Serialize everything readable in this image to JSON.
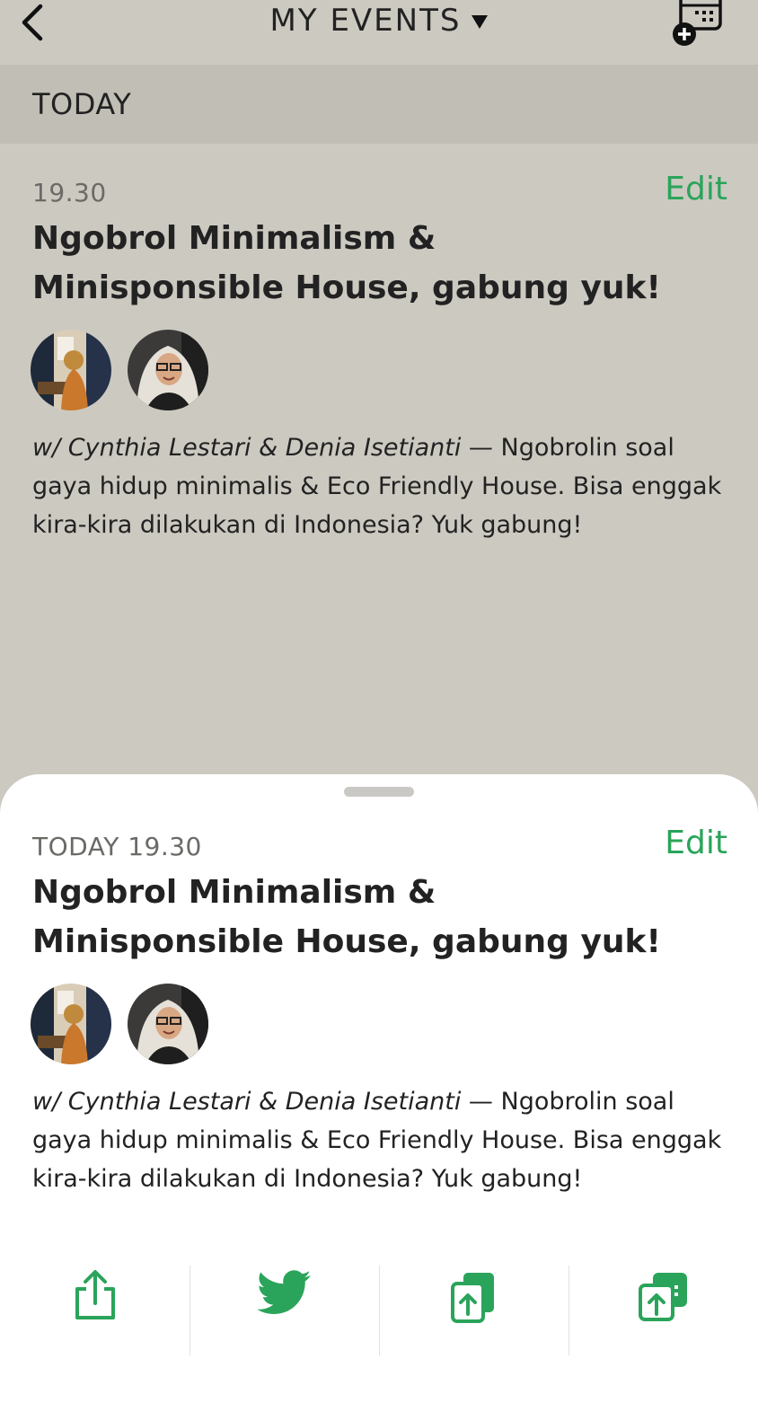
{
  "header": {
    "title": "MY EVENTS",
    "section": "TODAY"
  },
  "event_list_item": {
    "time": "19.30",
    "edit_label": "Edit",
    "title": "Ngobrol Minimalism & Minisponsible House, gabung yuk!",
    "hosts": "w/ Cynthia Lestari & Denia Isetianti",
    "separator": " — ",
    "description": "Ngobrolin soal gaya hidup minimalis & Eco Friendly House. Bisa enggak kira-kira dilakukan di Indonesia? Yuk gabung!",
    "avatars": [
      "Cynthia Lestari",
      "Denia Isetianti"
    ]
  },
  "sheet": {
    "time": "TODAY 19.30",
    "edit_label": "Edit",
    "title": "Ngobrol Minimalism & Minisponsible House, gabung yuk!",
    "hosts": "w/ Cynthia Lestari & Denia Isetianti",
    "separator": " — ",
    "description": "Ngobrolin soal gaya hidup minimalis & Eco Friendly House. Bisa enggak kira-kira dilakukan di Indonesia? Yuk gabung!",
    "actions": [
      "share-icon",
      "twitter-icon",
      "copy-link-icon",
      "add-to-calendar-icon"
    ]
  },
  "colors": {
    "accent_green": "#2aa45a",
    "background": "#ccc9c1",
    "section_header": "#c1beb6",
    "sheet": "#ffffff"
  }
}
